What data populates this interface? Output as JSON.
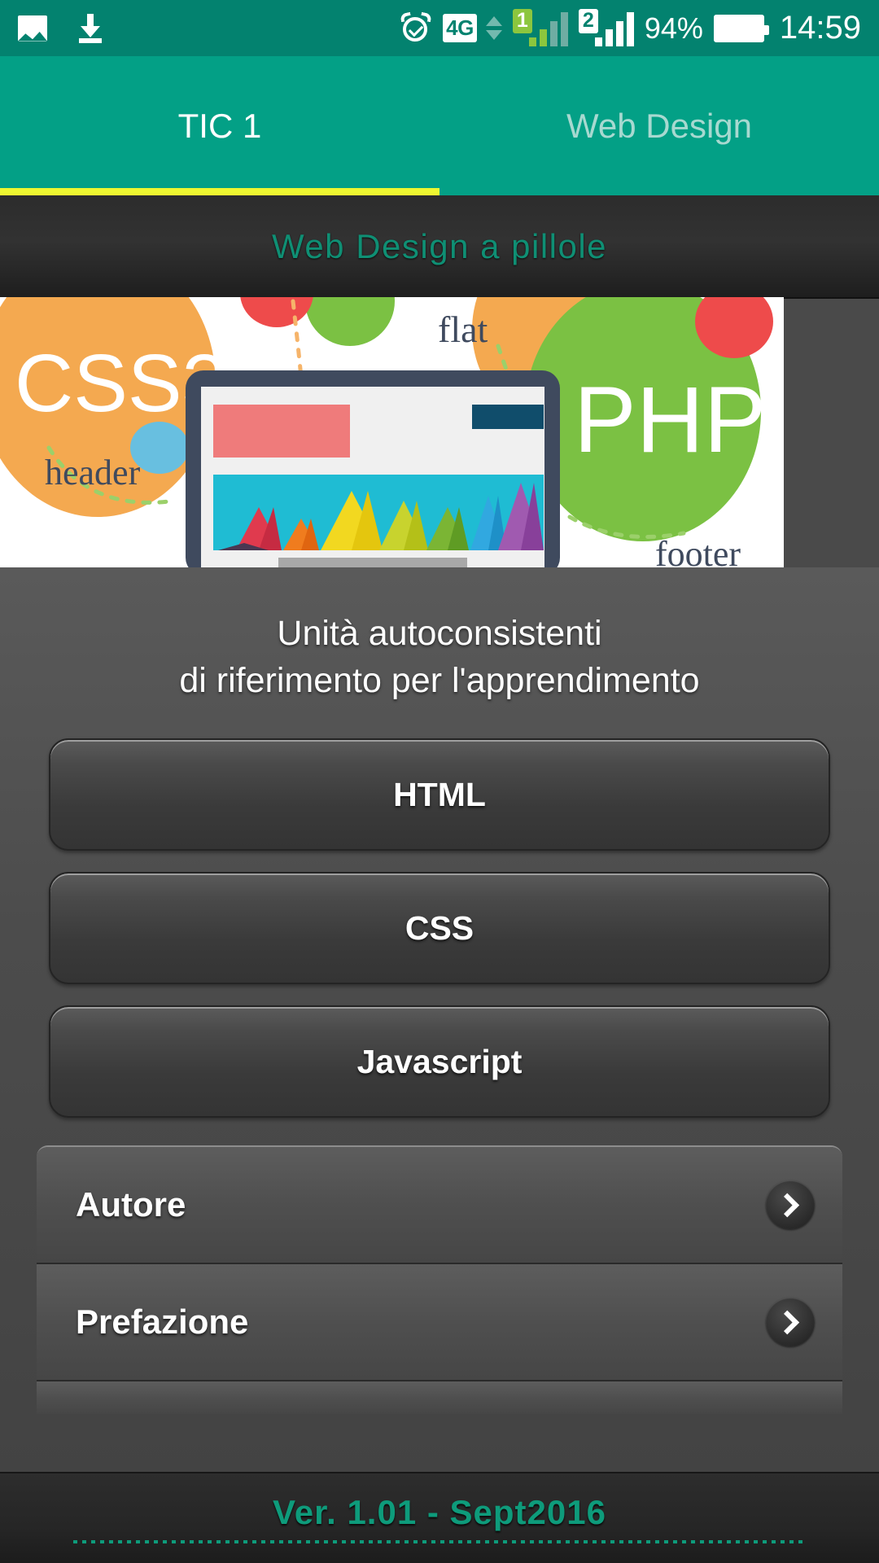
{
  "status_bar": {
    "icons_left": [
      "gallery-icon",
      "download-icon"
    ],
    "alarm_icon": "alarm-clock-icon",
    "network_type": "4G",
    "data_arrows_icon": "data-transfer-arrows-icon",
    "sim1_label": "1",
    "sim2_label": "2",
    "battery_percent": "94%",
    "battery_icon": "battery-full-icon",
    "clock": "14:59"
  },
  "tabs": [
    {
      "label": "TIC 1",
      "active": true
    },
    {
      "label": "Web Design",
      "active": false
    }
  ],
  "app_title": "Web Design a pillole",
  "banner": {
    "labels": {
      "css3": "CSS3",
      "php": "PHP",
      "flat": "flat",
      "header": "header",
      "footer": "footer"
    },
    "colors": {
      "orange": "#f4a950",
      "green": "#7bc143",
      "red": "#ee4b4b",
      "blue": "#68bfe0",
      "teal": "#1fbcd3",
      "device_frame": "#3f4a5e",
      "salmon": "#ef7b7b",
      "navy": "#104d6b"
    }
  },
  "subtitle": {
    "line1": "Unità autoconsistenti",
    "line2": "di riferimento per l'apprendimento"
  },
  "buttons": [
    {
      "label": "HTML"
    },
    {
      "label": "CSS"
    },
    {
      "label": "Javascript"
    }
  ],
  "list_items": [
    {
      "label": "Autore",
      "chevron": "chevron-right-icon"
    },
    {
      "label": "Prefazione",
      "chevron": "chevron-right-icon"
    }
  ],
  "footer": {
    "version": "Ver. 1.01 - Sept2016"
  },
  "theme": {
    "status_bar_bg": "#03826f",
    "tab_bar_bg": "#03a086",
    "tab_indicator": "#eef731",
    "title_accent": "#0f8f74",
    "footer_accent": "#0e9b7b",
    "content_bg": "#4c4c4c"
  }
}
